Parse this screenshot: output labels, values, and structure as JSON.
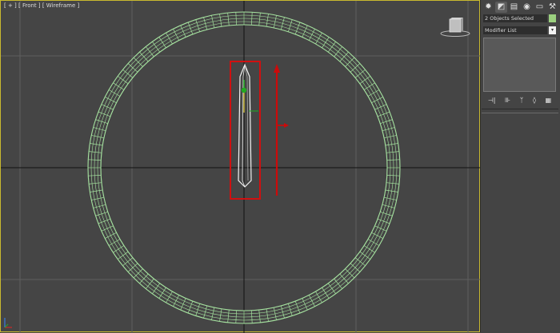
{
  "viewport": {
    "label": "[ + ] [ Front ] [ Wireframe ]",
    "colors": {
      "background": "#454545",
      "grid": "#5e5e5e",
      "axis": "#111111",
      "ring_wire": "#a6e3a0",
      "selection_box": "#d01010",
      "gizmo_y": "#cc0a0a",
      "gizmo_x": "#22aa22",
      "active_border": "#c9b92f"
    }
  },
  "command_panel": {
    "tabs": [
      "create-icon",
      "modify-icon",
      "hierarchy-icon",
      "motion-icon",
      "display-icon",
      "utilities-icon"
    ],
    "selection_name": "2 Objects Selected",
    "selection_color": "#9bd07f",
    "modifier_list": "Modifier List",
    "stack_tools": [
      "pin-stack-icon",
      "show-end-result-icon",
      "make-unique-icon",
      "remove-modifier-icon",
      "configure-sets-icon"
    ]
  }
}
